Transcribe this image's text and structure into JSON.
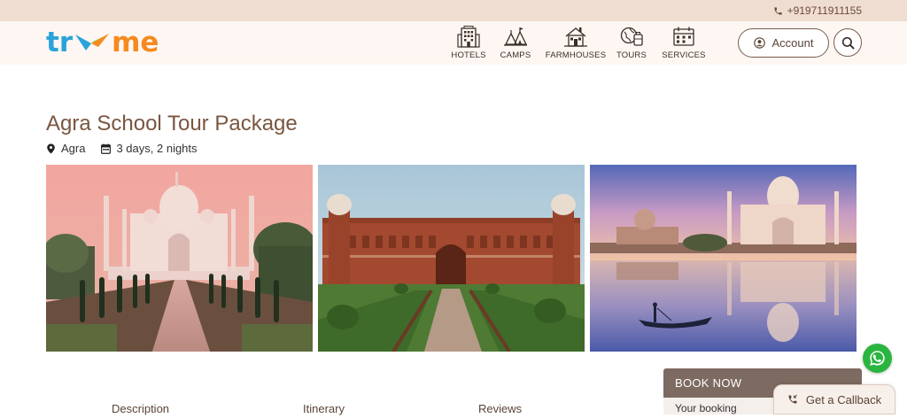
{
  "topbar": {
    "phone": "+919711911155"
  },
  "logo": {
    "part1": "tr",
    "part2": "me"
  },
  "nav": [
    {
      "label": "HOTELS",
      "icon": "hotel-icon"
    },
    {
      "label": "CAMPS",
      "icon": "camp-icon"
    },
    {
      "label": "FARMHOUSES",
      "icon": "farmhouse-icon"
    },
    {
      "label": "TOURS",
      "icon": "tour-icon"
    },
    {
      "label": "SERVICES",
      "icon": "services-icon"
    }
  ],
  "account": {
    "label": "Account"
  },
  "page": {
    "title": "Agra School Tour Package",
    "location": "Agra",
    "duration": "3 days, 2 nights"
  },
  "gallery": [
    {
      "icon": "taj-mahal-photo"
    },
    {
      "icon": "agra-fort-photo"
    },
    {
      "icon": "taj-mahal-river-photo"
    }
  ],
  "tabs": [
    {
      "label": "Description"
    },
    {
      "label": "Itinerary"
    },
    {
      "label": "Reviews"
    }
  ],
  "booking": {
    "header": "BOOK NOW",
    "body": "Your booking"
  },
  "callback": {
    "label": "Get a Callback"
  },
  "colors": {
    "brand_brown": "#7a563f",
    "topbar": "#f0ddd2",
    "logo_blue": "#2aa3db",
    "logo_orange": "#f58a1f",
    "whatsapp": "#2ab540"
  }
}
